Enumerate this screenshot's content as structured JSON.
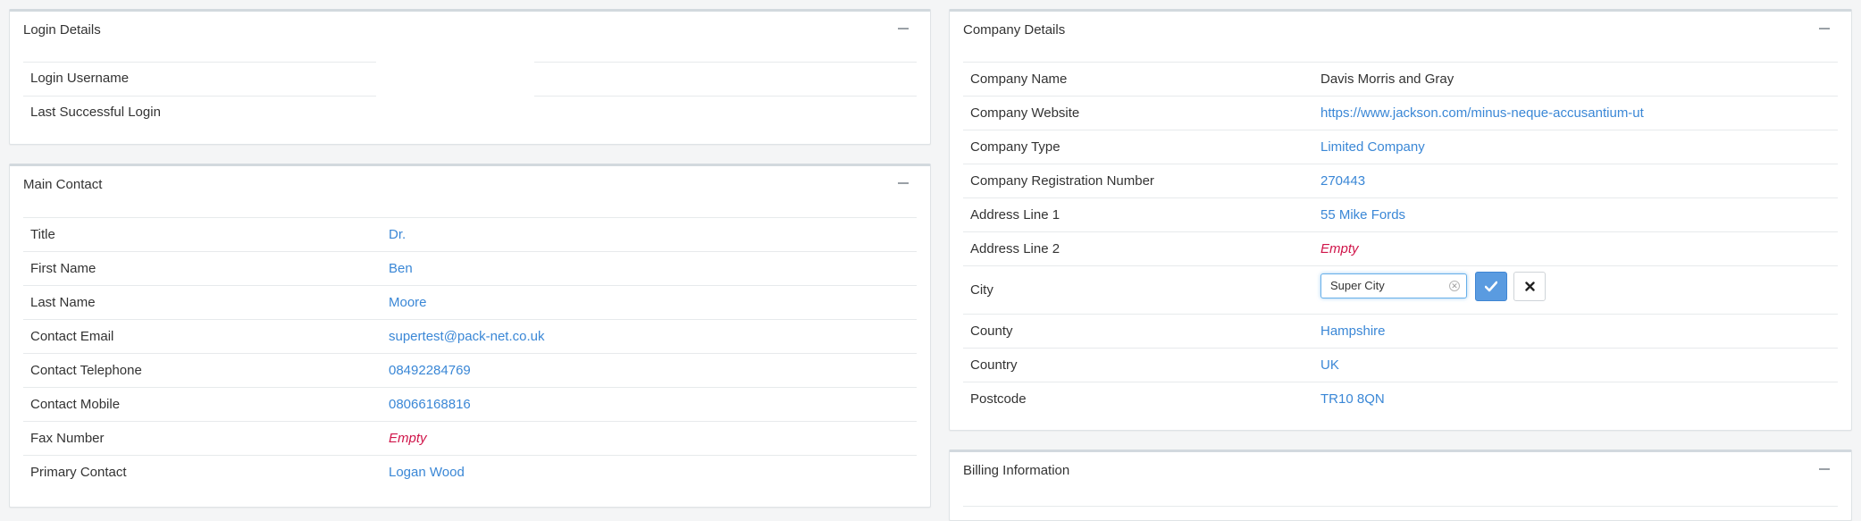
{
  "login_details": {
    "title": "Login Details",
    "rows": [
      {
        "label": "Login Username",
        "value": ""
      },
      {
        "label": "Last Successful Login",
        "value": ""
      }
    ]
  },
  "main_contact": {
    "title": "Main Contact",
    "rows": [
      {
        "label": "Title",
        "value": "Dr."
      },
      {
        "label": "First Name",
        "value": "Ben"
      },
      {
        "label": "Last Name",
        "value": "Moore"
      },
      {
        "label": "Contact Email",
        "value": "supertest@pack-net.co.uk"
      },
      {
        "label": "Contact Telephone",
        "value": "08492284769"
      },
      {
        "label": "Contact Mobile",
        "value": "08066168816"
      },
      {
        "label": "Fax Number",
        "value": "Empty"
      },
      {
        "label": "Primary Contact",
        "value": "Logan Wood"
      }
    ]
  },
  "company_details": {
    "title": "Company Details",
    "rows": [
      {
        "label": "Company Name",
        "value": "Davis Morris and Gray"
      },
      {
        "label": "Company Website",
        "value": "https://www.jackson.com/minus-neque-accusantium-ut"
      },
      {
        "label": "Company Type",
        "value": "Limited Company"
      },
      {
        "label": "Company Registration Number",
        "value": "270443"
      },
      {
        "label": "Address Line 1",
        "value": "55 Mike Fords"
      },
      {
        "label": "Address Line 2",
        "value": "Empty"
      },
      {
        "label": "City",
        "value": "Super City"
      },
      {
        "label": "County",
        "value": "Hampshire"
      },
      {
        "label": "Country",
        "value": "UK"
      },
      {
        "label": "Postcode",
        "value": "TR10 8QN"
      }
    ]
  },
  "billing_information": {
    "title": "Billing Information"
  },
  "colors": {
    "link": "#3a87d6",
    "empty": "#d0154a",
    "confirm_button": "#5a9be0"
  },
  "icons": {
    "collapse": "minus-icon",
    "confirm": "check-icon",
    "cancel": "times-icon",
    "clear": "clear-circle-icon"
  }
}
